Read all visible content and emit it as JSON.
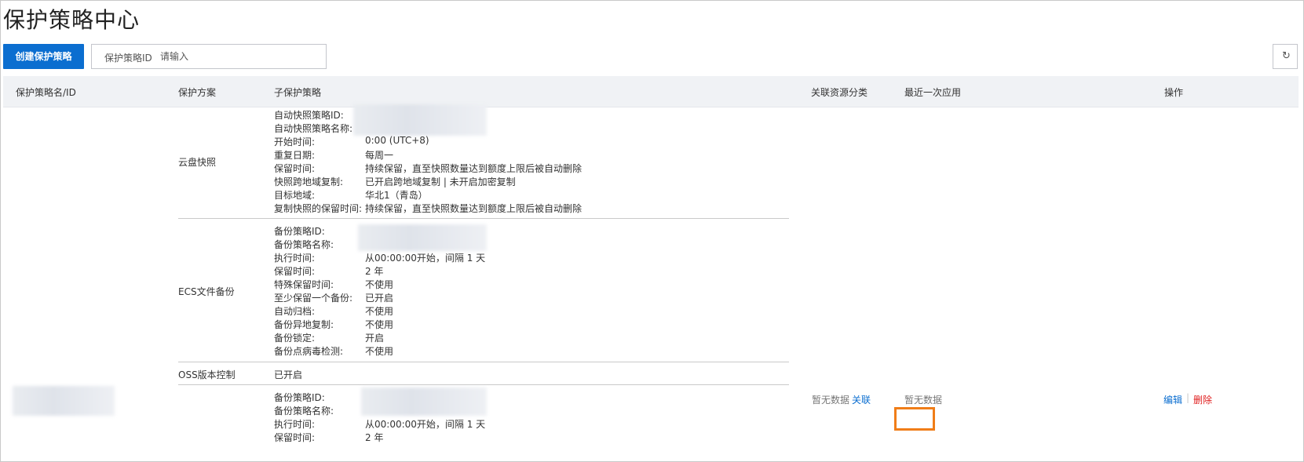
{
  "page": {
    "title": "保护策略中心"
  },
  "toolbar": {
    "create_label": "创建保护策略",
    "search_label": "保护策略ID",
    "search_placeholder": "请输入",
    "refresh_icon": "refresh-icon"
  },
  "table": {
    "headers": [
      "保护策略名/ID",
      "保护方案",
      "子保护策略",
      "关联资源分类",
      "最近一次应用",
      "操作"
    ],
    "row": {
      "schemes": {
        "snapshot": {
          "name": "云盘快照",
          "fields": [
            {
              "k": "自动快照策略ID:",
              "v": ""
            },
            {
              "k": "自动快照策略名称:",
              "v": ""
            },
            {
              "k": "开始时间:",
              "v": "0:00 (UTC+8)"
            },
            {
              "k": "重复日期:",
              "v": "每周一"
            },
            {
              "k": "保留时间:",
              "v": "持续保留，直至快照数量达到额度上限后被自动删除"
            },
            {
              "k": "快照跨地域复制:",
              "v": "已开启跨地域复制 | 未开启加密复制"
            },
            {
              "k": "目标地域:",
              "v": "华北1（青岛）"
            },
            {
              "k": "复制快照的保留时间:",
              "v": "持续保留，直至快照数量达到额度上限后被自动删除"
            }
          ]
        },
        "ecs": {
          "name": "ECS文件备份",
          "fields": [
            {
              "k": "备份策略ID:",
              "v": ""
            },
            {
              "k": "备份策略名称:",
              "v": ""
            },
            {
              "k": "执行时间:",
              "v": "从00:00:00开始，间隔 1 天"
            },
            {
              "k": "保留时间:",
              "v": "2 年"
            },
            {
              "k": "特殊保留时间:",
              "v": "不使用"
            },
            {
              "k": "至少保留一个备份:",
              "v": "已开启"
            },
            {
              "k": "自动归档:",
              "v": "不使用"
            },
            {
              "k": "备份异地复制:",
              "v": "不使用"
            },
            {
              "k": "备份锁定:",
              "v": "开启"
            },
            {
              "k": "备份点病毒检测:",
              "v": "不使用"
            }
          ]
        },
        "oss": {
          "name": "OSS版本控制",
          "value": "已开启"
        },
        "fourth": {
          "fields": [
            {
              "k": "备份策略ID:",
              "v": ""
            },
            {
              "k": "备份策略名称:",
              "v": ""
            },
            {
              "k": "执行时间:",
              "v": "从00:00:00开始，间隔 1 天"
            },
            {
              "k": "保留时间:",
              "v": "2 年"
            }
          ]
        }
      },
      "resource_empty": "暂无数据",
      "assoc_link": "关联",
      "last_apply": "暂无数据",
      "actions": {
        "edit": "编辑",
        "divider": "|",
        "delete": "删除"
      }
    }
  }
}
